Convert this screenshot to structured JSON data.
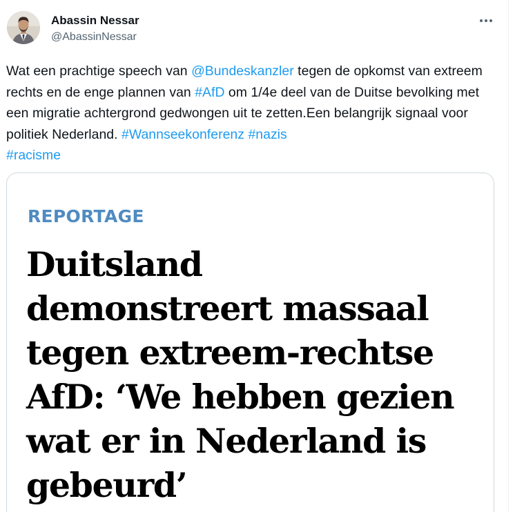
{
  "author": {
    "name": "Abassin Nessar",
    "handle": "@AbassinNessar",
    "avatar_icon": "profile-photo"
  },
  "more_icon": "ellipsis-icon",
  "tweet": {
    "segments": [
      {
        "text": "Wat een prachtige speech van ",
        "type": "text"
      },
      {
        "text": "@Bundeskanzler",
        "type": "mention"
      },
      {
        "text": " tegen de opkomst van extreem rechts en de enge plannen van ",
        "type": "text"
      },
      {
        "text": "#AfD",
        "type": "hashtag"
      },
      {
        "text": " om 1/4e deel van de Duitse bevolking met een migratie achtergrond gedwongen uit te zetten.Een belangrijk signaal voor politiek Nederland. ",
        "type": "text"
      },
      {
        "text": "#Wannseekonferenz",
        "type": "hashtag"
      },
      {
        "text": " ",
        "type": "text"
      },
      {
        "text": "#nazis",
        "type": "hashtag"
      },
      {
        "text": " ",
        "type": "text"
      },
      {
        "text": "#racisme",
        "type": "hashtag"
      }
    ]
  },
  "card": {
    "kicker": "REPORTAGE",
    "headline_lines": [
      "Duitsland",
      "demonstreert massaal",
      "tegen extreem-rechtse",
      "AfD: ‘We hebben gezien",
      "wat er in Nederland is",
      "gebeurd’"
    ]
  },
  "colors": {
    "link": "#1d9bf0",
    "kicker": "#4f8bc1",
    "text": "#0f1419",
    "secondary": "#536471"
  }
}
